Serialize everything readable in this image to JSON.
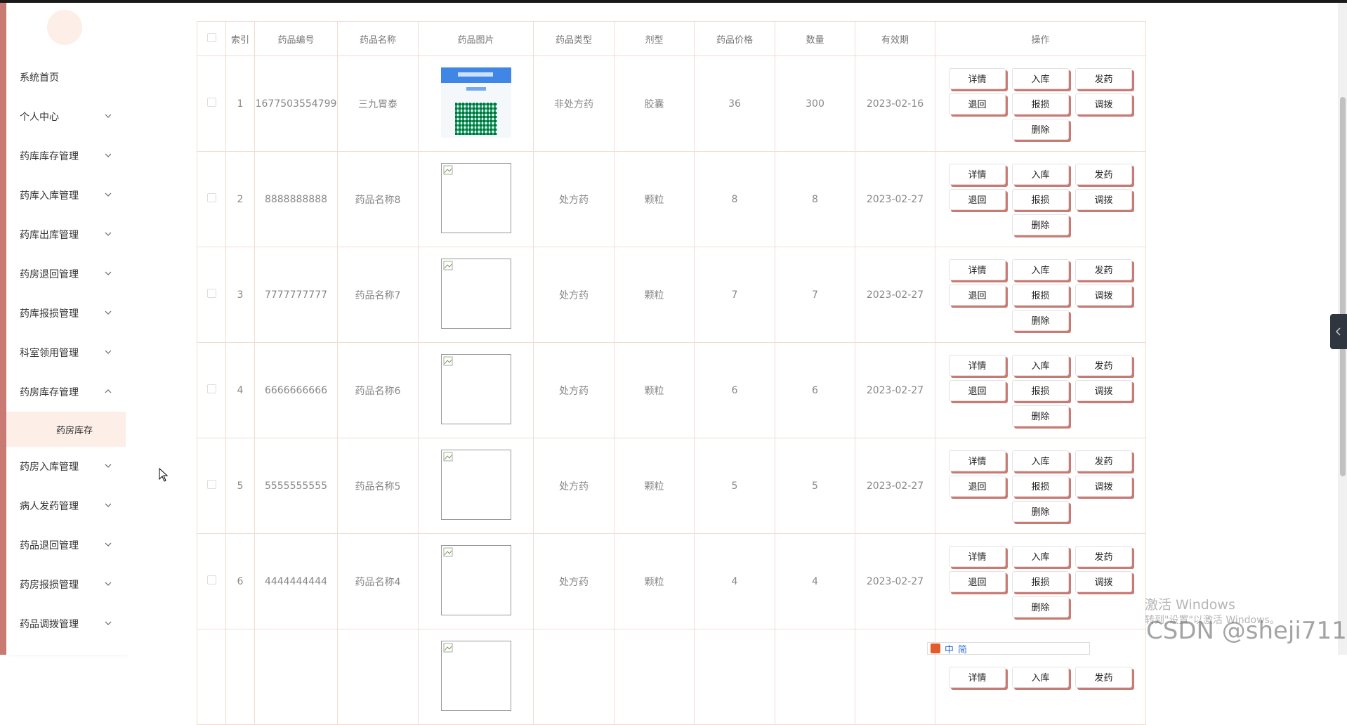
{
  "sidebar": {
    "items": [
      {
        "label": "系统首页",
        "has_chevron": false
      },
      {
        "label": "个人中心",
        "has_chevron": true
      },
      {
        "label": "药库库存管理",
        "has_chevron": true
      },
      {
        "label": "药库入库管理",
        "has_chevron": true
      },
      {
        "label": "药库出库管理",
        "has_chevron": true
      },
      {
        "label": "药房退回管理",
        "has_chevron": true
      },
      {
        "label": "药库报损管理",
        "has_chevron": true
      },
      {
        "label": "科室领用管理",
        "has_chevron": true
      },
      {
        "label": "药房库存管理",
        "has_chevron": true,
        "expanded": true
      }
    ],
    "subitem": {
      "label": "药房库存"
    },
    "items_after": [
      {
        "label": "药房入库管理"
      },
      {
        "label": "病人发药管理"
      },
      {
        "label": "药品退回管理"
      },
      {
        "label": "药房报损管理"
      },
      {
        "label": "药品调拨管理"
      }
    ],
    "accent_color": "#c97a72",
    "active_bg": "#fdeee7"
  },
  "table": {
    "headers": [
      "索引",
      "药品编号",
      "药品名称",
      "药品图片",
      "药品类型",
      "剂型",
      "药品价格",
      "数量",
      "有效期",
      "操作"
    ],
    "rows": [
      {
        "index": "1",
        "code": "1677503554799",
        "name": "三九胃泰",
        "image": "qr",
        "type": "非处方药",
        "form": "胶囊",
        "price": "36",
        "qty": "300",
        "expiry": "2023-02-16"
      },
      {
        "index": "2",
        "code": "8888888888",
        "name": "药品名称8",
        "image": "broken",
        "type": "处方药",
        "form": "颗粒",
        "price": "8",
        "qty": "8",
        "expiry": "2023-02-27"
      },
      {
        "index": "3",
        "code": "7777777777",
        "name": "药品名称7",
        "image": "broken",
        "type": "处方药",
        "form": "颗粒",
        "price": "7",
        "qty": "7",
        "expiry": "2023-02-27"
      },
      {
        "index": "4",
        "code": "6666666666",
        "name": "药品名称6",
        "image": "broken",
        "type": "处方药",
        "form": "颗粒",
        "price": "6",
        "qty": "6",
        "expiry": "2023-02-27"
      },
      {
        "index": "5",
        "code": "5555555555",
        "name": "药品名称5",
        "image": "broken",
        "type": "处方药",
        "form": "颗粒",
        "price": "5",
        "qty": "5",
        "expiry": "2023-02-27"
      },
      {
        "index": "6",
        "code": "4444444444",
        "name": "药品名称4",
        "image": "broken",
        "type": "处方药",
        "form": "颗粒",
        "price": "4",
        "qty": "4",
        "expiry": "2023-02-27"
      }
    ],
    "actions": [
      "详情",
      "入库",
      "发药",
      "退回",
      "报损",
      "调拨",
      "删除"
    ],
    "partial_row_actions": [
      "详情",
      "入库",
      "发药"
    ]
  },
  "overlay": {
    "activate_windows": "激活 Windows",
    "activate_hint": "转到\"设置\"以激活 Windows。",
    "csdn": "CSDN @sheji711",
    "ime_chars": [
      "中",
      "简"
    ]
  }
}
